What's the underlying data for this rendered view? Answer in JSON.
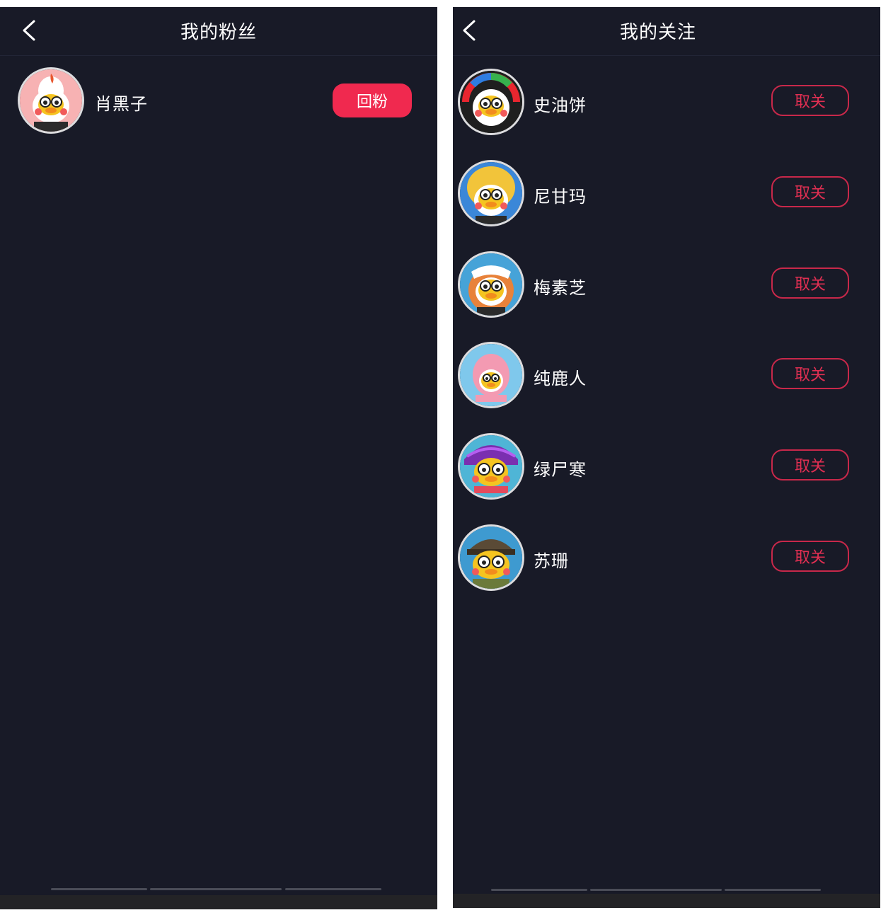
{
  "fans_screen": {
    "title": "我的粉丝",
    "items": [
      {
        "name": "肖黑子",
        "button": "回粉"
      }
    ]
  },
  "follow_screen": {
    "title": "我的关注",
    "items": [
      {
        "name": "史油饼",
        "button": "取关"
      },
      {
        "name": "尼甘玛",
        "button": "取关"
      },
      {
        "name": "梅素芝",
        "button": "取关"
      },
      {
        "name": "纯鹿人",
        "button": "取关"
      },
      {
        "name": "绿尸寒",
        "button": "取关"
      },
      {
        "name": "苏珊",
        "button": "取关"
      }
    ]
  },
  "colors": {
    "background": "#181a27",
    "accent": "#f0294f",
    "outline": "#c8284a"
  },
  "icons": {
    "back": "chevron-left-icon",
    "avatar": "duck-avatar-icon"
  }
}
